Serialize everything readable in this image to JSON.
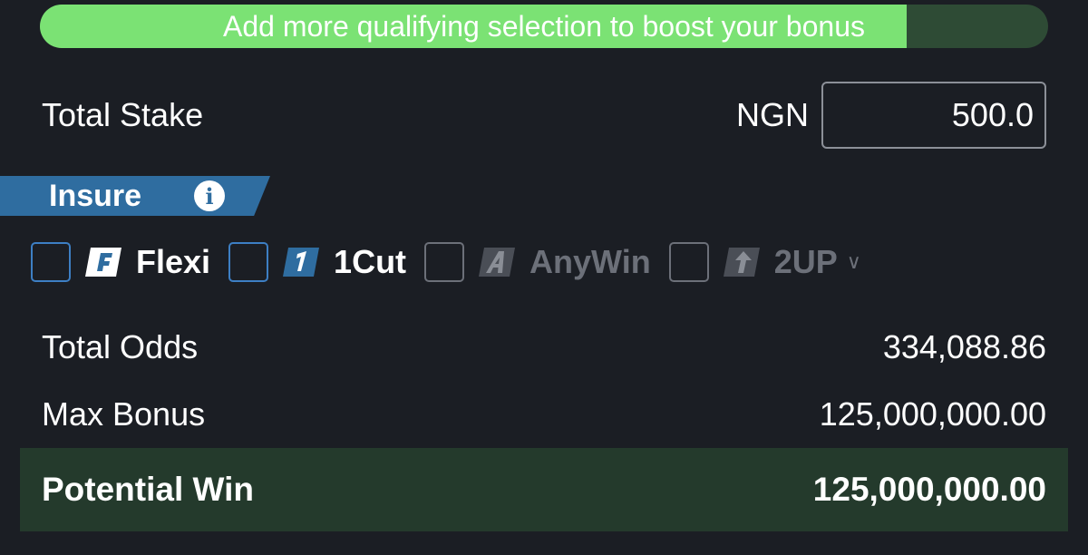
{
  "progress": {
    "message": "Add more qualifying selection to boost your bonus",
    "fill_fraction": 0.86,
    "fill_color": "#7be274",
    "track_color": "#2e4b35"
  },
  "stake": {
    "label": "Total Stake",
    "currency": "NGN",
    "value": "500.0"
  },
  "insure": {
    "label": "Insure",
    "info_icon": "info-icon",
    "color": "#2f6da0"
  },
  "options": [
    {
      "label": "Flexi",
      "icon": "F",
      "checked": false,
      "enabled": true
    },
    {
      "label": "1Cut",
      "icon": "1",
      "checked": false,
      "enabled": true
    },
    {
      "label": "AnyWin",
      "icon": "A",
      "checked": false,
      "enabled": false
    },
    {
      "label": "2UP",
      "icon": "up-arrow-icon",
      "checked": false,
      "enabled": false
    }
  ],
  "summary": {
    "total_odds_label": "Total Odds",
    "total_odds": "334,088.86",
    "max_bonus_label": "Max Bonus",
    "max_bonus": "125,000,000.00",
    "potential_win_label": "Potential Win",
    "potential_win": "125,000,000.00"
  }
}
